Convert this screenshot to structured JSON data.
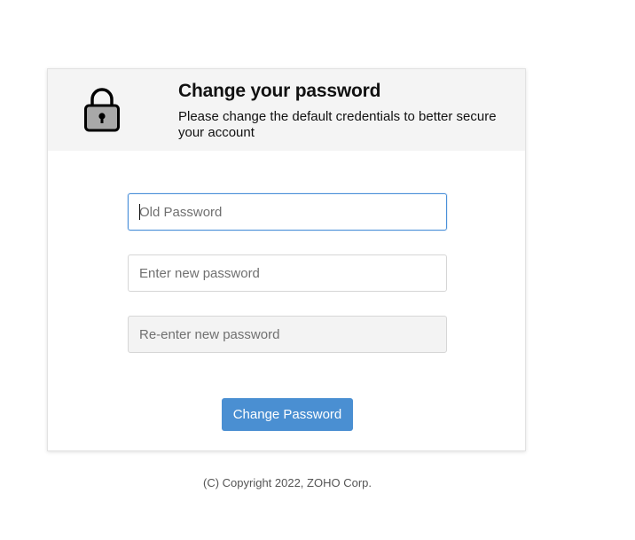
{
  "header": {
    "title": "Change your password",
    "subtitle": "Please change the default credentials to better secure your account",
    "icon": "lock-icon"
  },
  "form": {
    "old_password_placeholder": "Old Password",
    "new_password_placeholder": "Enter new password",
    "reenter_password_placeholder": "Re-enter new password",
    "submit_label": "Change Password"
  },
  "footer": {
    "copyright": "(C) Copyright 2022, ZOHO Corp."
  },
  "colors": {
    "accent": "#4a8fd2",
    "header_bg": "#f4f4f4",
    "focus_border": "#4a90d9"
  }
}
